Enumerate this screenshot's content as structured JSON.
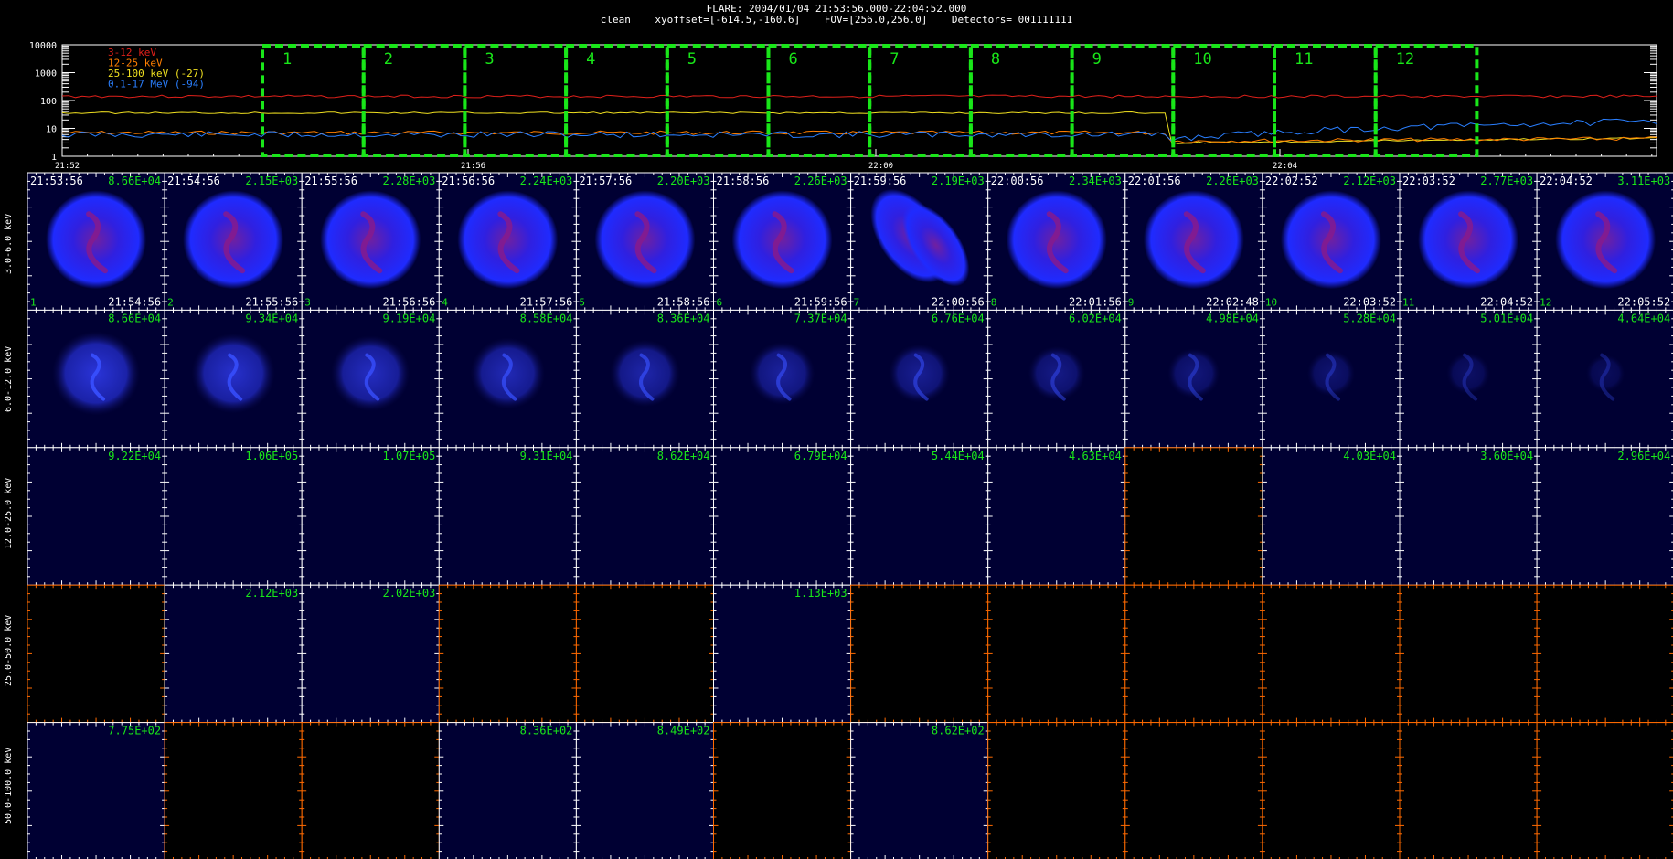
{
  "header": {
    "title": "FLARE: 2004/01/04 21:53:56.000-22:04:52.000",
    "subtitle": "clean    xyoffset=[-614.5,-160.6]    FOV=[256.0,256.0]    Detectors= 001111111"
  },
  "lightcurve": {
    "y_ticks": [
      "10000",
      "1000",
      "100",
      "10",
      "1"
    ],
    "x_ticks": [
      "21:52",
      "21:56",
      "22:00",
      "22:04"
    ],
    "legend": [
      {
        "label": "3-12 keV",
        "color": "#e0201a"
      },
      {
        "label": "12-25 keV",
        "color": "#ff7f00"
      },
      {
        "label": "25-100 keV (-27)",
        "color": "#f0e020"
      },
      {
        "label": "0.1-17 MeV (-94)",
        "color": "#2a7fff"
      }
    ],
    "intervals": [
      "1",
      "2",
      "3",
      "4",
      "5",
      "6",
      "7",
      "8",
      "9",
      "10",
      "11",
      "12"
    ],
    "interval_color": "#19e619"
  },
  "colors": {
    "panel_bg": "#000033",
    "empty_bg": "#000000",
    "white_frame": "#ffffff",
    "orange_frame": "#ff6a00",
    "value_text": "#19e619"
  },
  "time_labels": {
    "start": [
      "21:53:56",
      "21:54:56",
      "21:55:56",
      "21:56:56",
      "21:57:56",
      "21:58:56",
      "21:59:56",
      "22:00:56",
      "22:01:56",
      "22:02:52",
      "22:03:52",
      "22:04:52"
    ],
    "end": [
      "21:54:56",
      "21:55:56",
      "21:56:56",
      "21:57:56",
      "21:58:56",
      "21:59:56",
      "22:00:56",
      "22:01:56",
      "22:02:48",
      "22:03:52",
      "22:04:52",
      "22:05:52"
    ],
    "index": [
      "1",
      "2",
      "3",
      "4",
      "5",
      "6",
      "7",
      "8",
      "9",
      "10",
      "11",
      "12"
    ]
  },
  "rows": [
    {
      "label": "3.0-6.0 keV",
      "values": [
        "8.66E+04",
        "2.15E+03",
        "2.28E+03",
        "2.24E+03",
        "2.20E+03",
        "2.26E+03",
        "2.19E+03",
        "2.34E+03",
        "2.26E+03",
        "2.12E+03",
        "2.77E+03",
        "3.11E+03"
      ],
      "kind": [
        "full",
        "full",
        "full",
        "full",
        "full",
        "full",
        "full",
        "full",
        "full",
        "full",
        "full",
        "full"
      ]
    },
    {
      "label": "6.0-12.0 keV",
      "values": [
        "8.66E+04",
        "9.34E+04",
        "9.19E+04",
        "8.58E+04",
        "8.36E+04",
        "7.37E+04",
        "6.76E+04",
        "6.02E+04",
        "4.98E+04",
        "5.28E+04",
        "5.01E+04",
        "4.64E+04"
      ],
      "kind": [
        "mid",
        "mid",
        "mid",
        "mid",
        "mid",
        "mid",
        "mid",
        "mid",
        "mid",
        "mid",
        "mid",
        "mid"
      ]
    },
    {
      "label": "12.0-25.0 keV",
      "values": [
        "9.22E+04",
        "1.06E+05",
        "1.07E+05",
        "9.31E+04",
        "8.62E+04",
        "6.79E+04",
        "5.44E+04",
        "4.63E+04",
        "",
        "4.03E+04",
        "3.60E+04",
        "2.96E+04"
      ],
      "kind": [
        "faint",
        "faint",
        "faint",
        "faint",
        "faint",
        "faint",
        "faint",
        "faint",
        "empty",
        "faint",
        "faint",
        "faint"
      ]
    },
    {
      "label": "25.0-50.0 keV",
      "values": [
        "",
        "2.12E+03",
        "2.02E+03",
        "",
        "",
        "1.13E+03",
        "",
        "",
        "",
        "",
        "",
        ""
      ],
      "kind": [
        "empty",
        "faint",
        "faint",
        "empty",
        "empty",
        "faint",
        "empty",
        "empty",
        "empty",
        "empty",
        "empty",
        "empty"
      ]
    },
    {
      "label": "50.0-100.0 keV",
      "values": [
        "7.75E+02",
        "",
        "",
        "8.36E+02",
        "8.49E+02",
        "",
        "8.62E+02",
        "",
        "",
        "",
        "",
        ""
      ],
      "kind": [
        "faint",
        "empty",
        "empty",
        "faint",
        "faint",
        "empty",
        "faint",
        "empty",
        "empty",
        "empty",
        "empty",
        "empty"
      ]
    }
  ]
}
